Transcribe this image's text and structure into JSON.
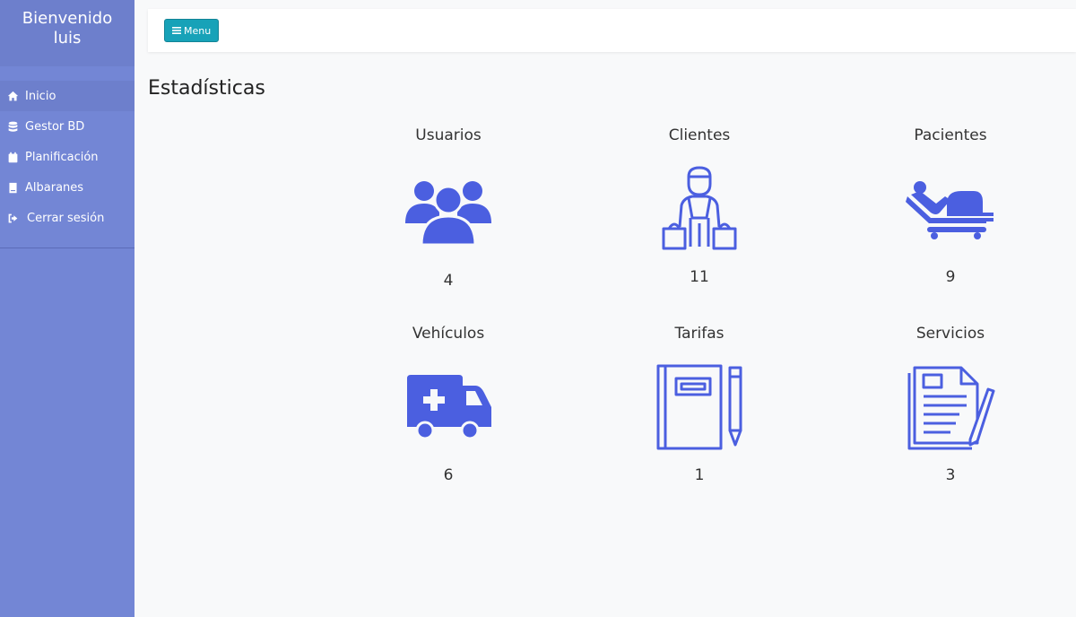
{
  "sidebar": {
    "welcome_line1": "Bienvenido",
    "welcome_line2": "luis",
    "items": [
      {
        "label": "Inicio",
        "icon": "home-icon"
      },
      {
        "label": "Gestor BD",
        "icon": "database-icon"
      },
      {
        "label": "Planificación",
        "icon": "calendar-icon"
      },
      {
        "label": "Albaranes",
        "icon": "book-icon"
      },
      {
        "label": "Cerrar sesión",
        "icon": "sign-out-icon"
      }
    ]
  },
  "topbar": {
    "menu_label": "Menu"
  },
  "page": {
    "title": "Estadísticas"
  },
  "stats": [
    {
      "label": "Usuarios",
      "value": "4",
      "icon": "users-icon"
    },
    {
      "label": "Clientes",
      "value": "11",
      "icon": "customer-icon"
    },
    {
      "label": "Pacientes",
      "value": "9",
      "icon": "patient-icon"
    },
    {
      "label": "Vehículos",
      "value": "6",
      "icon": "ambulance-icon"
    },
    {
      "label": "Tarifas",
      "value": "1",
      "icon": "notebook-icon"
    },
    {
      "label": "Servicios",
      "value": "3",
      "icon": "document-icon"
    }
  ],
  "colors": {
    "sidebar": "#7386d5",
    "sidebar_active": "#6d7fcc",
    "accent_icon": "#4b5fe0",
    "menu_button": "#17a2b8"
  }
}
